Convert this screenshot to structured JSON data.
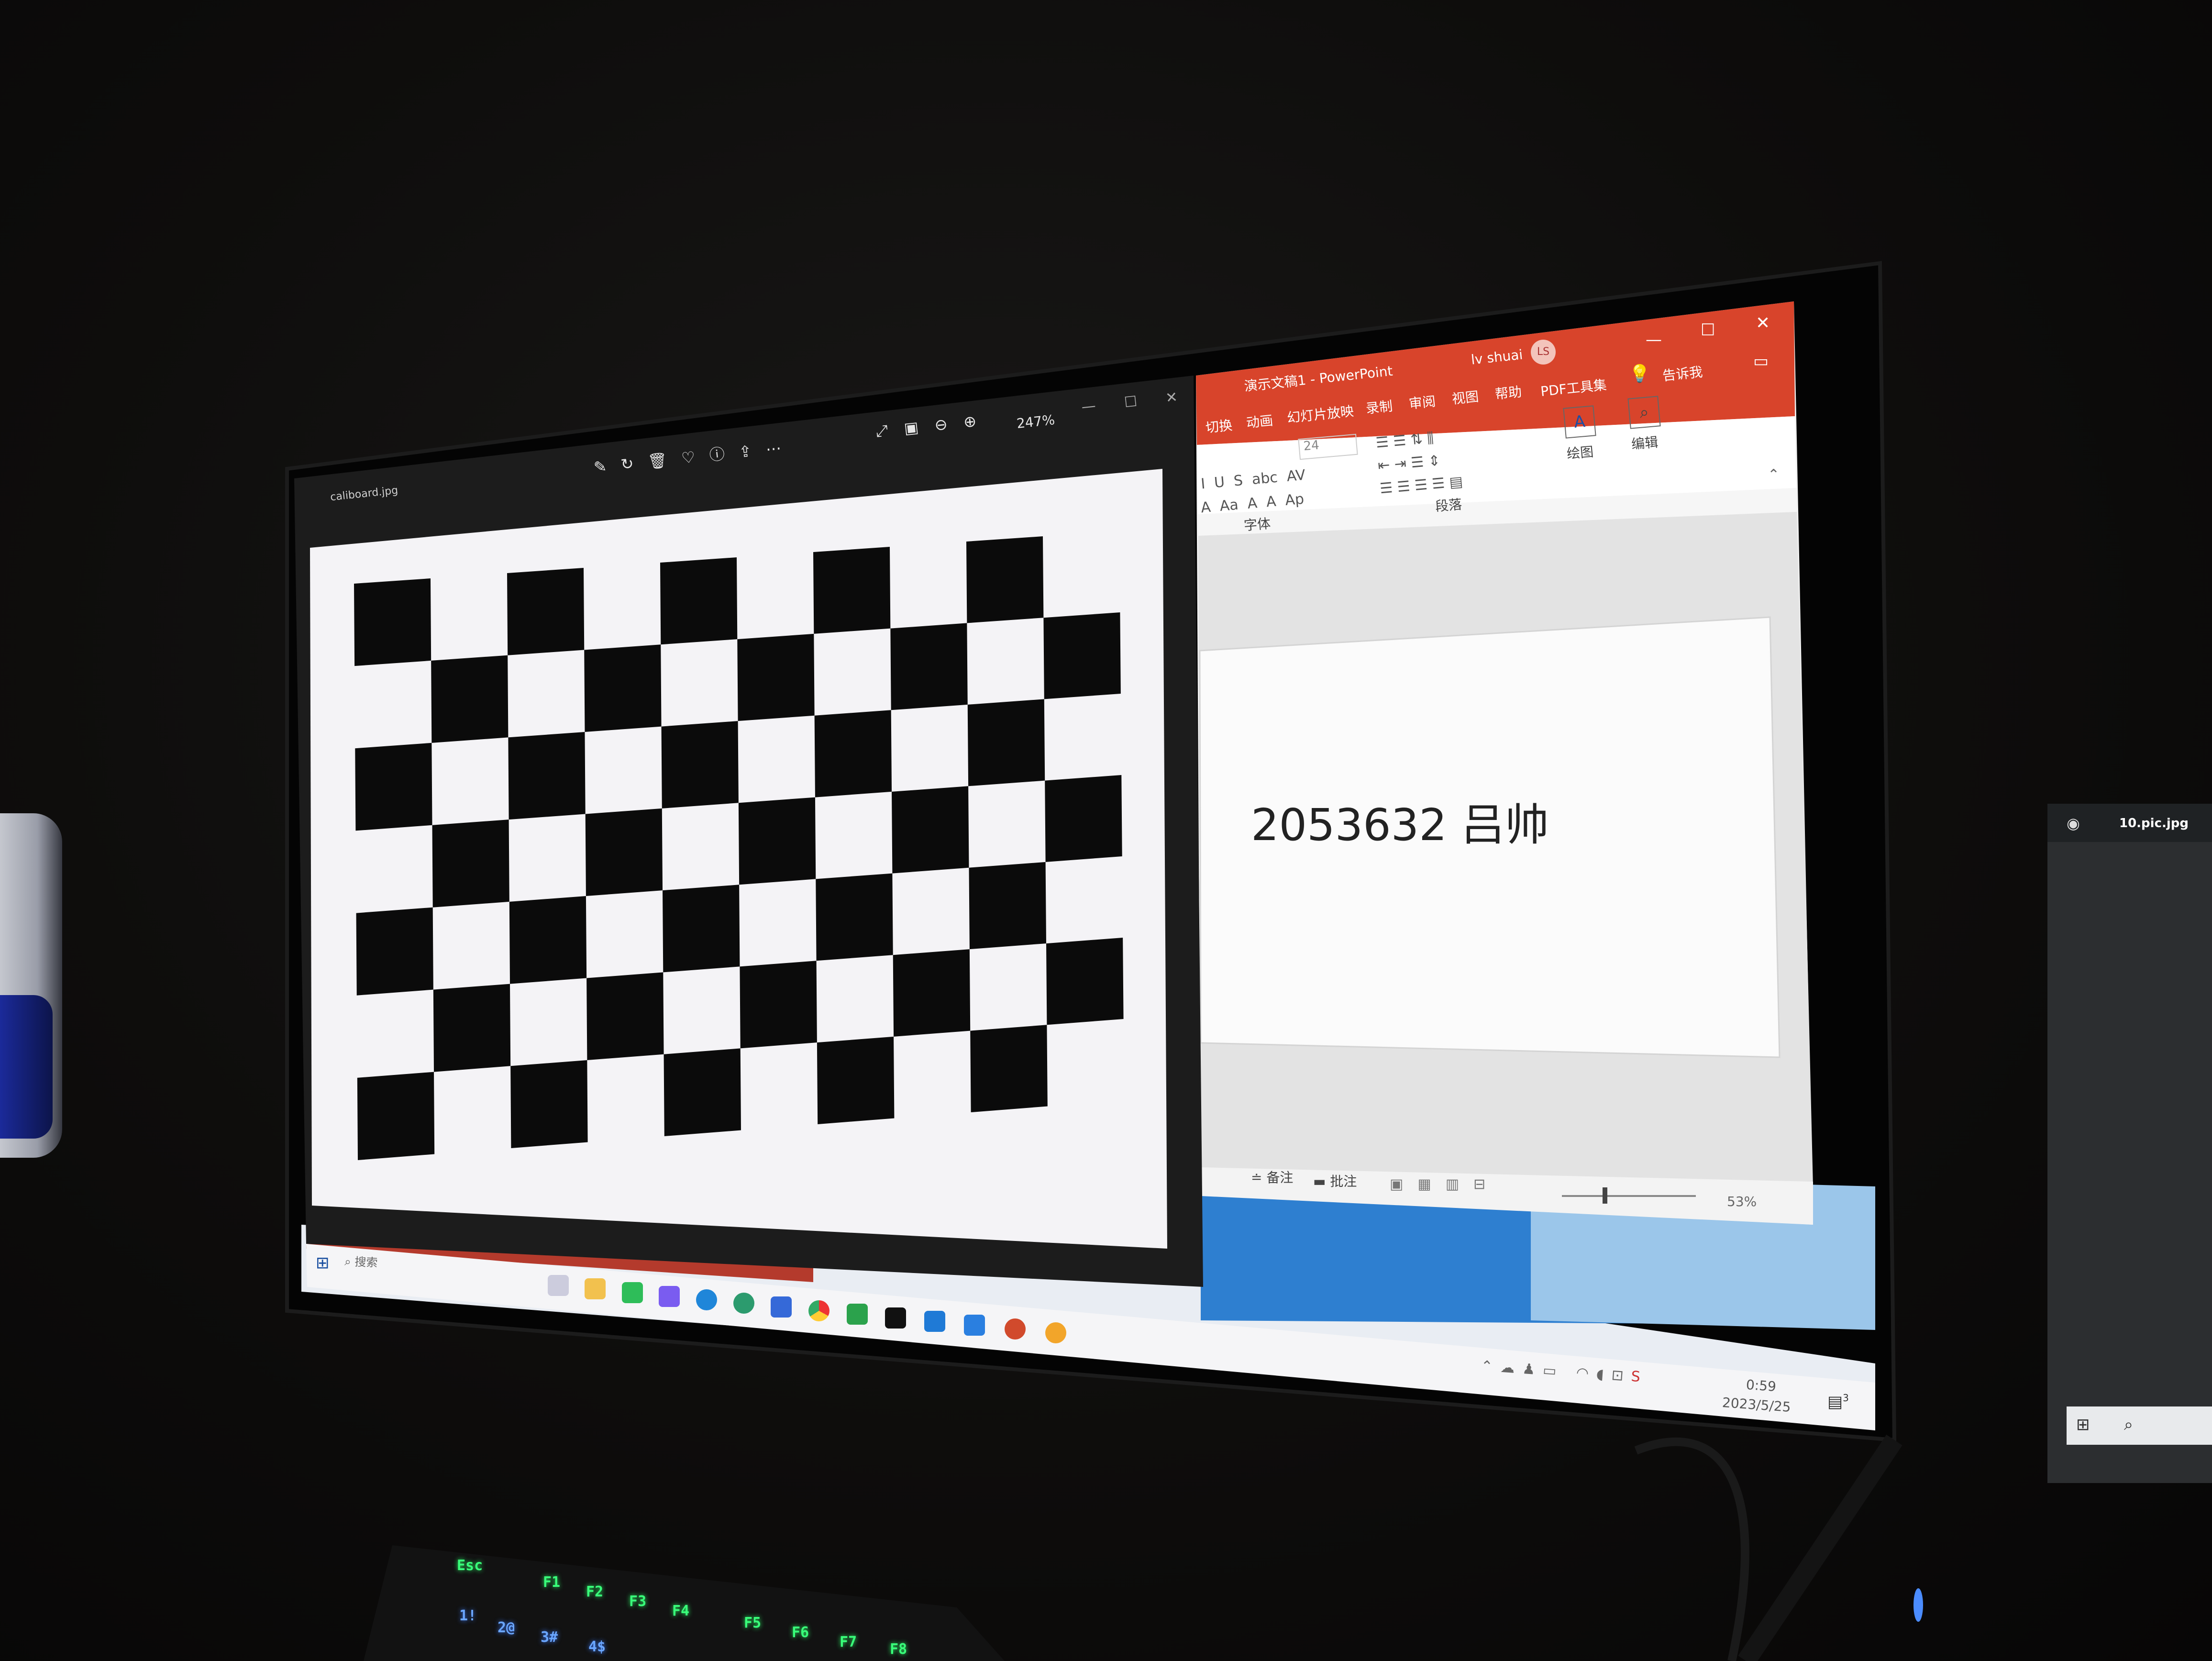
{
  "photos_window": {
    "filename": "caliboard.jpg",
    "zoom": "247%",
    "toolbar_icons": [
      "edit-icon",
      "rotate-icon",
      "delete-icon",
      "heart-icon",
      "info-icon",
      "share-icon",
      "more-icon"
    ],
    "view_icons": [
      "expand-icon",
      "fit-icon",
      "zoom-out-icon",
      "zoom-in-icon"
    ],
    "checkerboard": {
      "rows": 7,
      "cols": 10
    }
  },
  "powerpoint": {
    "title": "演示文稿1 - PowerPoint",
    "user": "lv shuai",
    "user_initials": "LS",
    "tabs": [
      "切换",
      "动画",
      "幻灯片放映",
      "录制",
      "审阅",
      "视图",
      "帮助",
      "PDF工具集"
    ],
    "tell_me": "告诉我",
    "groups": {
      "font": "字体",
      "paragraph": "段落",
      "draw": "绘图",
      "edit": "编辑"
    },
    "font_size": "24",
    "slide_text": "2053632 吕帅",
    "status_notes": "备注",
    "status_comments": "批注",
    "zoom": "53%"
  },
  "taskbar": {
    "search_placeholder": "搜索",
    "time": "0:59",
    "date": "2023/5/25",
    "notification_count": "3"
  },
  "second_monitor": {
    "filename": "10.pic.jpg"
  },
  "keyboard": {
    "keys": [
      "Esc",
      "F1",
      "F2",
      "F3",
      "F4",
      "F5",
      "F6",
      "F7",
      "F8",
      "1!",
      "2@",
      "3#",
      "4$"
    ]
  },
  "colors": {
    "ppt_accent": "#d8442b",
    "photos_bg": "#1e1e1e",
    "key_glow": "#39ff7a"
  }
}
